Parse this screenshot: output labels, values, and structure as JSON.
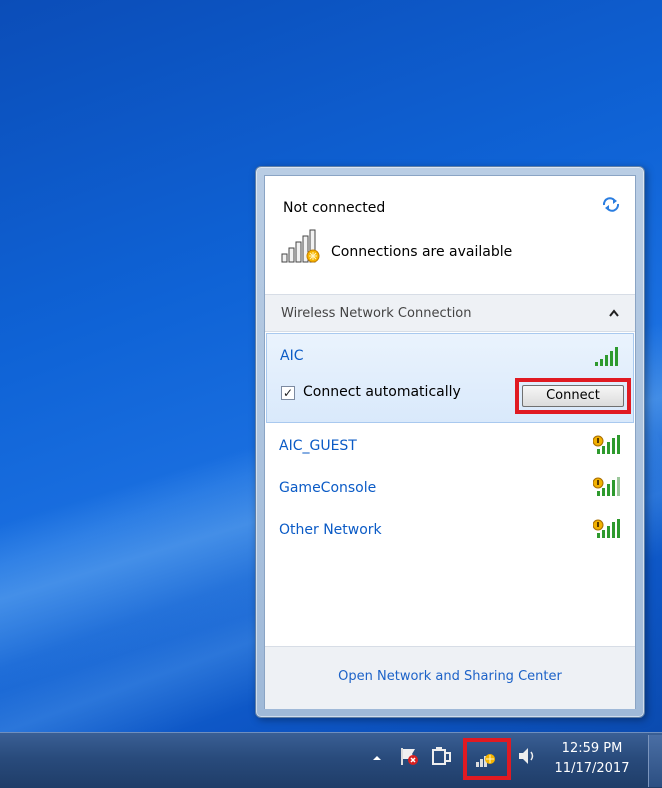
{
  "flyout": {
    "status": "Not connected",
    "availability": "Connections are available",
    "section_title": "Wireless Network Connection",
    "selected_network": {
      "name": "AIC",
      "connect_automatically_label": "Connect automatically",
      "connect_automatically_checked": true,
      "connect_button_label": "Connect",
      "secured": false
    },
    "networks": [
      {
        "name": "AIC_GUEST",
        "secured": true
      },
      {
        "name": "GameConsole",
        "secured": true
      },
      {
        "name": "Other Network",
        "secured": true
      }
    ],
    "footer_link": "Open Network and Sharing Center"
  },
  "taskbar": {
    "clock_time": "12:59 PM",
    "clock_date": "11/17/2017",
    "tray_icons": [
      "show-hidden-icons-arrow",
      "action-center-flag-icon",
      "power-icon",
      "network-icon",
      "volume-icon"
    ]
  },
  "colors": {
    "link_blue": "#1c62c8",
    "network_name_blue": "#0b5bc6",
    "highlight_red": "#e01a22",
    "signal_green": "#2e9a2e"
  }
}
